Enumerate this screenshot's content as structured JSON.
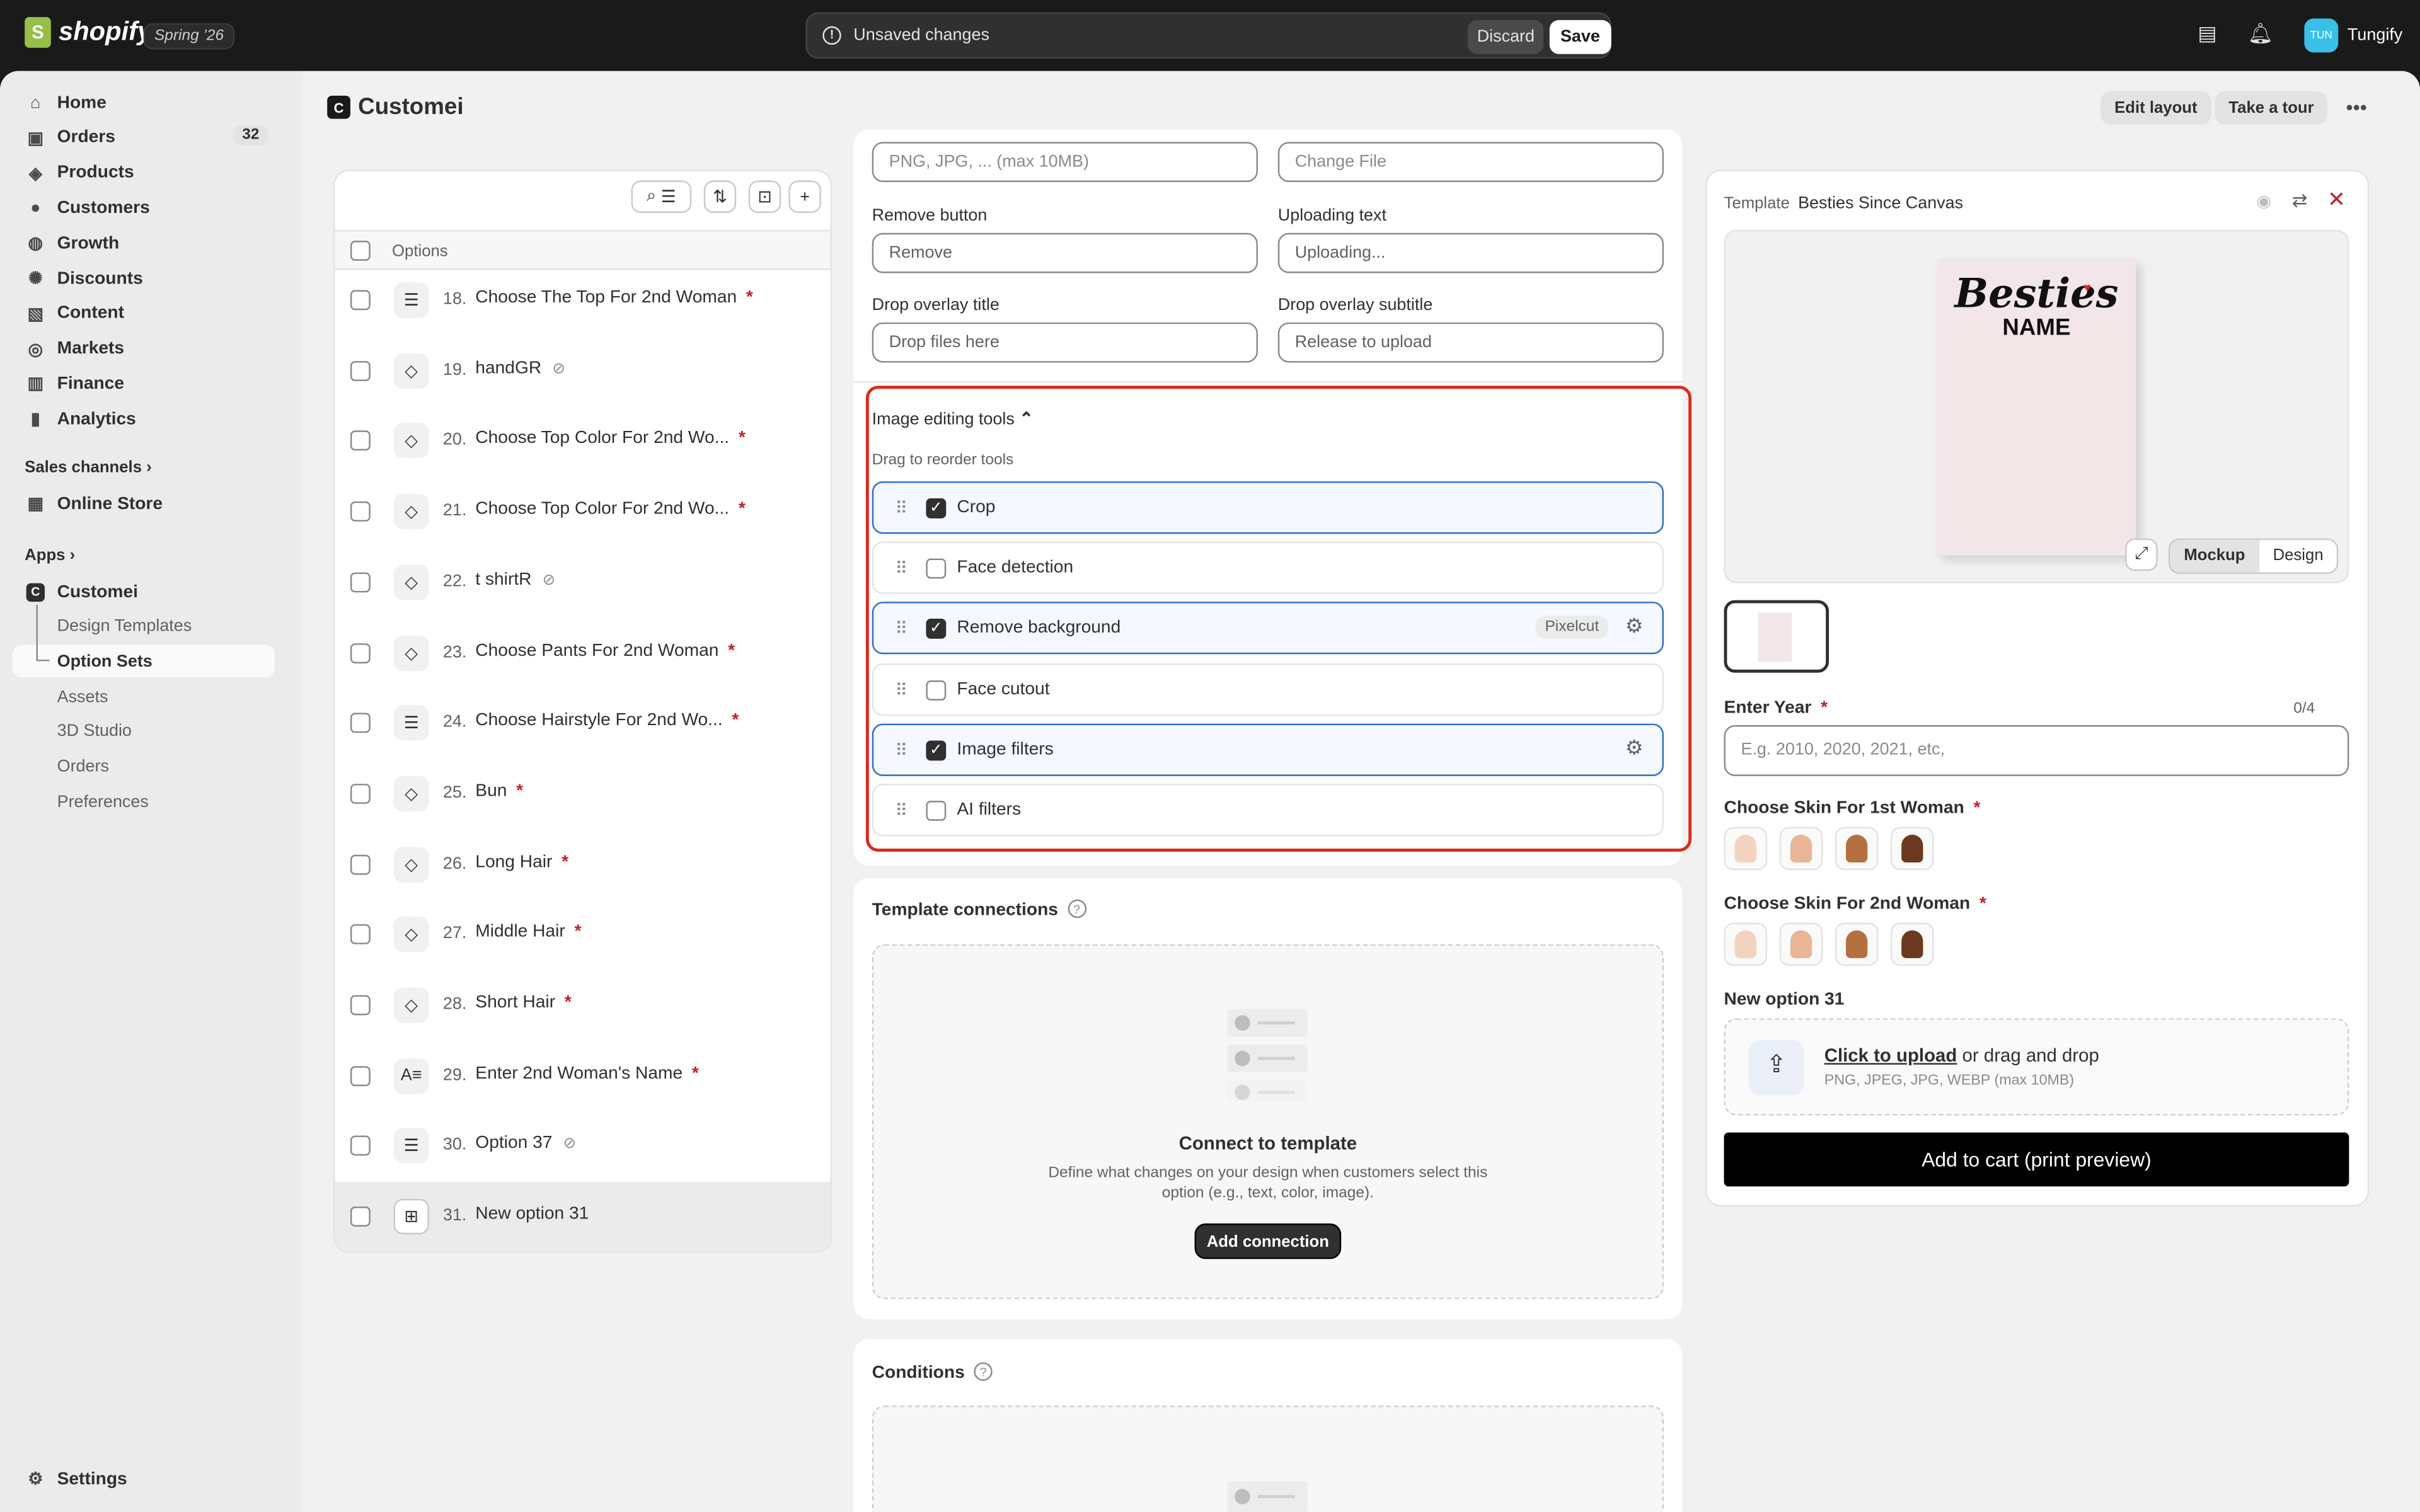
{
  "topbar": {
    "brand": "shopify",
    "release_badge": "Spring ’26",
    "unsaved_text": "Unsaved changes",
    "discard_label": "Discard",
    "save_label": "Save",
    "user_initials": "TUN",
    "user_name": "Tungify"
  },
  "sidebar": {
    "items": [
      {
        "label": "Home",
        "icon": "home-icon"
      },
      {
        "label": "Orders",
        "icon": "orders-icon",
        "badge": "32"
      },
      {
        "label": "Products",
        "icon": "tag-icon"
      },
      {
        "label": "Customers",
        "icon": "person-icon"
      },
      {
        "label": "Growth",
        "icon": "growth-icon"
      },
      {
        "label": "Discounts",
        "icon": "discount-icon"
      },
      {
        "label": "Content",
        "icon": "content-icon"
      },
      {
        "label": "Markets",
        "icon": "globe-icon"
      },
      {
        "label": "Finance",
        "icon": "bank-icon"
      },
      {
        "label": "Analytics",
        "icon": "bar-chart-icon"
      }
    ],
    "sales_channels_label": "Sales channels",
    "online_store_label": "Online Store",
    "apps_label": "Apps",
    "app_name": "Customei",
    "app_sub_items": [
      "Design Templates",
      "Option Sets",
      "Assets",
      "3D Studio",
      "Orders",
      "Preferences"
    ],
    "settings_label": "Settings"
  },
  "page": {
    "title": "Customei",
    "edit_layout_label": "Edit layout",
    "take_tour_label": "Take a tour"
  },
  "options_list": {
    "header_label": "Options",
    "rows": [
      {
        "num": "18.",
        "name": "Choose The Top For 2nd Woman",
        "icon": "list-icon",
        "required": true
      },
      {
        "num": "19.",
        "name": "handGR",
        "icon": "paint-bucket-icon",
        "hidden": true
      },
      {
        "num": "20.",
        "name": "Choose Top Color For 2nd Wo...",
        "icon": "paint-bucket-icon",
        "required": true
      },
      {
        "num": "21.",
        "name": "Choose Top Color For 2nd Wo...",
        "icon": "paint-bucket-icon",
        "required": true
      },
      {
        "num": "22.",
        "name": "t shirtR",
        "icon": "paint-bucket-icon",
        "hidden": true
      },
      {
        "num": "23.",
        "name": "Choose Pants For 2nd Woman",
        "icon": "paint-bucket-icon",
        "required": true
      },
      {
        "num": "24.",
        "name": "Choose Hairstyle For 2nd Wo...",
        "icon": "list-icon",
        "required": true
      },
      {
        "num": "25.",
        "name": "Bun",
        "icon": "paint-bucket-icon",
        "required": true
      },
      {
        "num": "26.",
        "name": "Long Hair",
        "icon": "paint-bucket-icon",
        "required": true
      },
      {
        "num": "27.",
        "name": "Middle Hair",
        "icon": "paint-bucket-icon",
        "required": true
      },
      {
        "num": "28.",
        "name": "Short Hair",
        "icon": "paint-bucket-icon",
        "required": true
      },
      {
        "num": "29.",
        "name": "Enter 2nd Woman's Name",
        "icon": "text-icon",
        "required": true
      },
      {
        "num": "30.",
        "name": "Option 37",
        "icon": "list-icon",
        "hidden": true
      },
      {
        "num": "31.",
        "name": "New option 31",
        "icon": "image-upload-icon",
        "selected": true
      }
    ]
  },
  "settings_form": {
    "file_types_placeholder": "PNG, JPG, ... (max 10MB)",
    "change_file_placeholder": "Change File",
    "remove_button_label": "Remove button",
    "remove_button_value": "Remove",
    "uploading_text_label": "Uploading text",
    "uploading_text_value": "Uploading...",
    "drop_title_label": "Drop overlay title",
    "drop_title_value": "Drop files here",
    "drop_subtitle_label": "Drop overlay subtitle",
    "drop_subtitle_value": "Release to upload"
  },
  "image_tools": {
    "title": "Image editing tools",
    "hint": "Drag to reorder tools",
    "tools": [
      {
        "name": "Crop",
        "checked": true
      },
      {
        "name": "Face detection",
        "checked": false
      },
      {
        "name": "Remove background",
        "checked": true,
        "badge": "Pixelcut",
        "settings": true
      },
      {
        "name": "Face cutout",
        "checked": false
      },
      {
        "name": "Image filters",
        "checked": true,
        "settings": true
      },
      {
        "name": "AI filters",
        "checked": false
      }
    ]
  },
  "template_connections": {
    "title": "Template connections",
    "empty_title": "Connect to template",
    "empty_desc": "Define what changes on your design when customers select this option (e.g., text, color, image).",
    "add_label": "Add connection"
  },
  "conditions": {
    "title": "Conditions"
  },
  "preview": {
    "template_label": "Template",
    "template_name": "Besties Since Canvas",
    "canvas_text_1": "Besties",
    "canvas_text_2": "NAME",
    "mockup_label": "Mockup",
    "design_label": "Design",
    "year_label": "Enter Year",
    "year_counter": "0/4",
    "year_placeholder": "E.g. 2010, 2020, 2021, etc,",
    "skin1_label": "Choose Skin For 1st Woman",
    "skin2_label": "Choose Skin For 2nd Woman",
    "skin_colors": [
      "#f3d3bd",
      "#e9b596",
      "#b4713f",
      "#6b3a1e"
    ],
    "new_option_label": "New option 31",
    "upload_link": "Click to upload",
    "upload_rest": "or drag and drop",
    "upload_types": "PNG, JPEG, JPG, WEBP (max 10MB)",
    "add_to_cart": "Add to cart (print preview)"
  },
  "colors": {
    "accent": "#2c6ecb",
    "highlight": "#d92b1d",
    "required": "#c71e2a"
  }
}
